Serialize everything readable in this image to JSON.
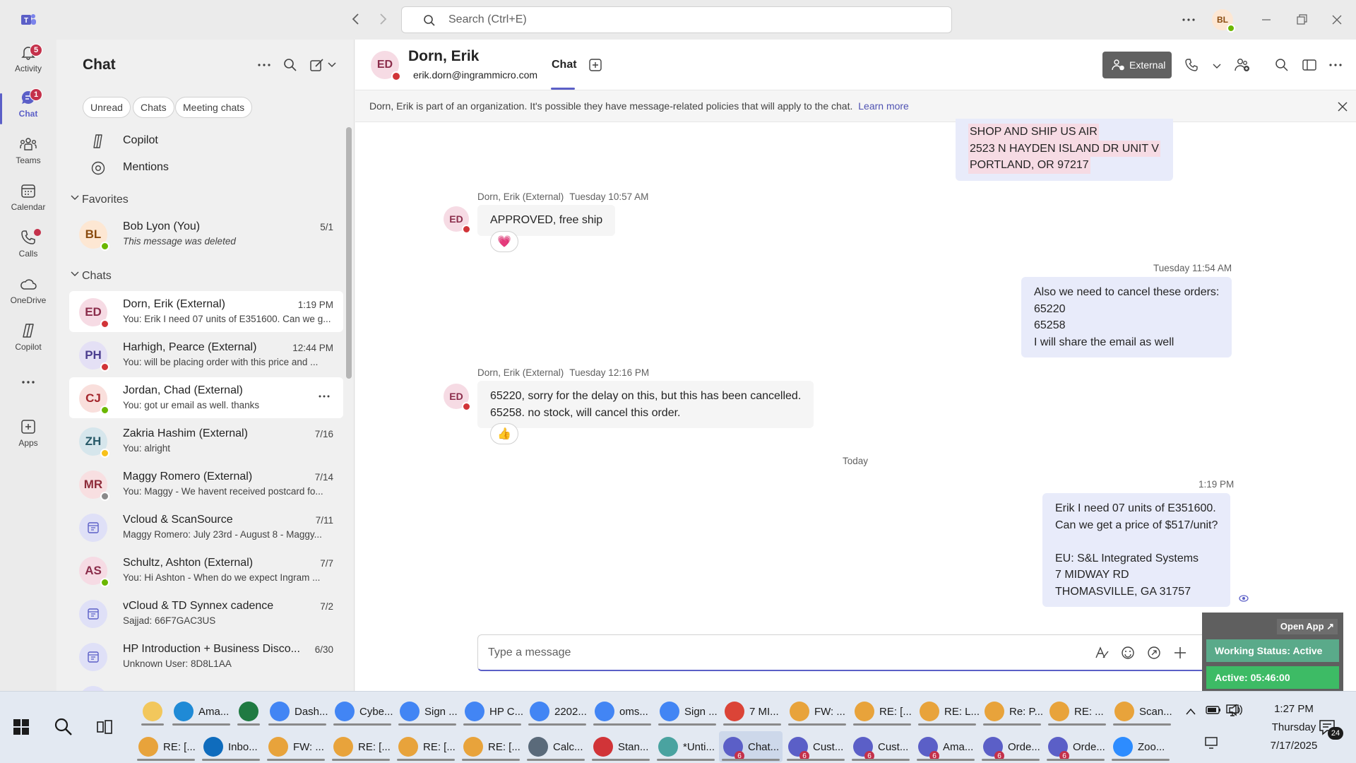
{
  "titlebar": {
    "search_placeholder": "Search (Ctrl+E)",
    "user_initials": "BL"
  },
  "rail": [
    {
      "label": "Activity",
      "badge": "5"
    },
    {
      "label": "Chat",
      "badge": "1"
    },
    {
      "label": "Teams",
      "badge": ""
    },
    {
      "label": "Calendar",
      "badge": ""
    },
    {
      "label": "Calls",
      "badge": ""
    },
    {
      "label": "OneDrive",
      "badge": ""
    },
    {
      "label": "Copilot",
      "badge": ""
    },
    {
      "label": "...",
      "badge": ""
    },
    {
      "label": "Apps",
      "badge": ""
    }
  ],
  "list": {
    "title": "Chat",
    "filters": [
      "Unread",
      "Chats",
      "Meeting chats"
    ],
    "pinned": [
      "Copilot",
      "Mentions"
    ],
    "favorites_label": "Favorites",
    "chats_label": "Chats",
    "favorites": [
      {
        "initials": "BL",
        "name": "Bob Lyon (You)",
        "preview": "This message was deleted",
        "time": "5/1",
        "status": "#6bb700",
        "bg": "#fde7d3",
        "fg": "#8a4b0f"
      }
    ],
    "chats": [
      {
        "initials": "ED",
        "name": "Dorn, Erik  (External)",
        "preview": "You: Erik I need 07 units of E351600. Can we g...",
        "time": "1:19 PM",
        "status": "#d13438",
        "bg": "#f6dbe4",
        "fg": "#8b2d4b"
      },
      {
        "initials": "PH",
        "name": "Harhigh, Pearce  (External)",
        "preview": "You: will be placing order with this price and ...",
        "time": "12:44 PM",
        "status": "#d13438",
        "bg": "#e4e0f5",
        "fg": "#4b3d8f"
      },
      {
        "initials": "CJ",
        "name": "Jordan, Chad  (External)",
        "preview": "You: got ur email as well. thanks",
        "time": "",
        "status": "#6bb700",
        "bg": "#f9dfdc",
        "fg": "#a4262c"
      },
      {
        "initials": "ZH",
        "name": "Zakria Hashim  (External)",
        "preview": "You: alright",
        "time": "7/16",
        "status": "#f8c11a",
        "bg": "#d6e6ec",
        "fg": "#285a69"
      },
      {
        "initials": "MR",
        "name": "Maggy Romero  (External)",
        "preview": "You: Maggy - We havent received postcard fo...",
        "time": "7/14",
        "status": "#8a8a8a",
        "bg": "#f8dfe1",
        "fg": "#8e2c3a"
      },
      {
        "initials": "",
        "name": "Vcloud & ScanSource",
        "preview": "Maggy Romero: July 23rd - August 8 - Maggy...",
        "time": "7/11",
        "status": "",
        "bg": "#dfe0f7",
        "fg": "#5b5fc7"
      },
      {
        "initials": "AS",
        "name": "Schultz, Ashton  (External)",
        "preview": "You: Hi Ashton -  When do we expect Ingram ...",
        "time": "7/7",
        "status": "#6bb700",
        "bg": "#f6dbe4",
        "fg": "#8b2d4b"
      },
      {
        "initials": "",
        "name": "vCloud & TD Synnex cadence",
        "preview": "Sajjad: 66F7GAC3US",
        "time": "7/2",
        "status": "",
        "bg": "#dfe0f7",
        "fg": "#5b5fc7"
      },
      {
        "initials": "",
        "name": "HP Introduction + Business Disco...",
        "preview": "Unknown User: 8D8L1AA",
        "time": "6/30",
        "status": "",
        "bg": "#dfe0f7",
        "fg": "#5b5fc7"
      }
    ]
  },
  "header": {
    "initials": "ED",
    "name": "Dorn, Erik",
    "email": "erik.dorn@ingrammicro.com",
    "tab": "Chat",
    "external_label": "External"
  },
  "notice": {
    "text": "Dorn, Erik is part of an organization. It's possible they have message-related policies that will apply to the chat.",
    "link": "Learn more"
  },
  "messages": {
    "top_out": [
      "SHOP AND SHIP US AIR",
      "2523 N HAYDEN ISLAND DR UNIT V",
      "PORTLAND, OR 97217"
    ],
    "m1_sender": "Dorn, Erik (External)",
    "m1_time": "Tuesday 10:57 AM",
    "m1_text": "APPROVED, free ship",
    "m1_react": "💗",
    "m2_time": "Tuesday 11:54 AM",
    "m2_lines": [
      "Also we need to cancel these orders:",
      "65220",
      "65258",
      "I will share the email as well"
    ],
    "m3_sender": "Dorn, Erik (External)",
    "m3_time": "Tuesday 12:16 PM",
    "m3_lines": [
      "65220, sorry for the delay on this, but this has been cancelled.",
      "65258. no stock, will cancel this order."
    ],
    "m3_react": "👍",
    "divider": "Today",
    "m4_time": "1:19 PM",
    "m4_lines": [
      "Erik I need 07 units of E351600.",
      "Can we get a price of $517/unit?",
      "",
      "EU: S&L Integrated Systems",
      "7 MIDWAY RD",
      "THOMASVILLE, GA 31757"
    ]
  },
  "compose_placeholder": "Type a message",
  "widget": {
    "open": "Open App ↗",
    "status": "Working Status: Active",
    "active": "Active: 05:46:00"
  },
  "taskbar": {
    "row1": [
      {
        "label": "",
        "color": "#f2c75c"
      },
      {
        "label": "Ama...",
        "color": "#1f8ad6"
      },
      {
        "label": "",
        "color": "#1f7a42"
      },
      {
        "label": "Dash...",
        "color": "#4285f4"
      },
      {
        "label": "Cybe...",
        "color": "#4285f4"
      },
      {
        "label": "Sign ...",
        "color": "#4285f4"
      },
      {
        "label": "HP C...",
        "color": "#4285f4"
      },
      {
        "label": "2202...",
        "color": "#4285f4"
      },
      {
        "label": "oms...",
        "color": "#4285f4"
      },
      {
        "label": "Sign ...",
        "color": "#4285f4"
      },
      {
        "label": "7 MI...",
        "color": "#db4437"
      },
      {
        "label": "FW: ...",
        "color": "#e8a33b"
      },
      {
        "label": "RE: [...",
        "color": "#e8a33b"
      },
      {
        "label": "RE: L...",
        "color": "#e8a33b"
      },
      {
        "label": "Re: P...",
        "color": "#e8a33b"
      },
      {
        "label": "RE: ...",
        "color": "#e8a33b"
      },
      {
        "label": "Scan...",
        "color": "#e8a33b"
      }
    ],
    "row2": [
      {
        "label": "RE: [...",
        "color": "#e8a33b"
      },
      {
        "label": "Inbo...",
        "color": "#0f6cbd"
      },
      {
        "label": "FW: ...",
        "color": "#e8a33b"
      },
      {
        "label": "RE: [...",
        "color": "#e8a33b"
      },
      {
        "label": "RE: [...",
        "color": "#e8a33b"
      },
      {
        "label": "RE: [...",
        "color": "#e8a33b"
      },
      {
        "label": "Calc...",
        "color": "#5a6a7a"
      },
      {
        "label": "Stan...",
        "color": "#d13438"
      },
      {
        "label": "*Unti...",
        "color": "#4aa3a0"
      },
      {
        "label": "Chat...",
        "color": "#5b5fc7"
      },
      {
        "label": "Cust...",
        "color": "#5b5fc7"
      },
      {
        "label": "Cust...",
        "color": "#5b5fc7"
      },
      {
        "label": "Ama...",
        "color": "#5b5fc7"
      },
      {
        "label": "Orde...",
        "color": "#5b5fc7"
      },
      {
        "label": "Orde...",
        "color": "#5b5fc7"
      },
      {
        "label": "Zoo...",
        "color": "#2d8cff"
      }
    ],
    "time": "1:27 PM",
    "day": "Thursday",
    "date": "7/17/2025",
    "notif": "24"
  }
}
